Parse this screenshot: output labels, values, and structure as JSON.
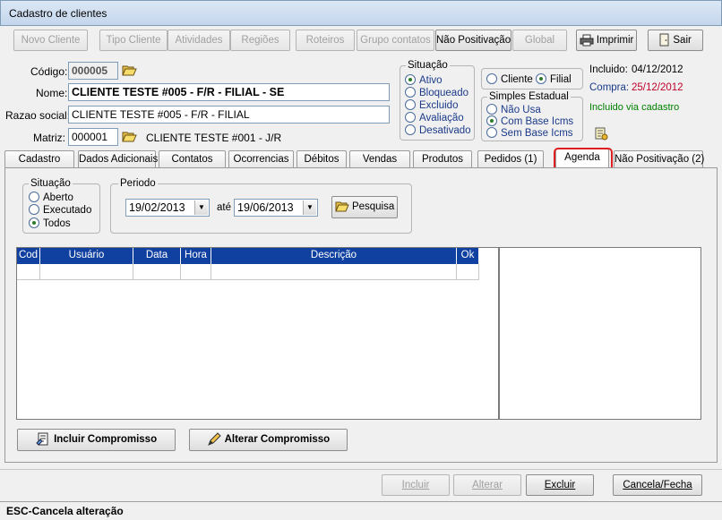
{
  "window": {
    "title": "Cadastro de clientes"
  },
  "toolbar": {
    "novo_cliente": "Novo Cliente",
    "tipo_cliente": "Tipo Cliente",
    "atividades": "Atividades",
    "regioes": "Regiões",
    "roteiros": "Roteiros",
    "grupo_contatos": "Grupo contatos",
    "nao_positivacao": "Não Positivação",
    "global": "Global",
    "imprimir": "Imprimir",
    "sair": "Sair"
  },
  "form": {
    "codigo_label": "Código:",
    "codigo_value": "000005",
    "nome_label": "Nome:",
    "nome_value": "CLIENTE TESTE #005 - F/R - FILIAL - SE",
    "razao_label": "Razao social:",
    "razao_value": "CLIENTE TESTE #005 - F/R - FILIAL",
    "matriz_label": "Matriz:",
    "matriz_value": "000001",
    "matriz_name": "CLIENTE TESTE #001 - J/R"
  },
  "situacao": {
    "title": "Situação",
    "options": [
      "Ativo",
      "Bloqueado",
      "Excluido",
      "Avaliação",
      "Desativado"
    ],
    "selected": "Ativo"
  },
  "tipo": {
    "cliente": "Cliente",
    "filial": "Filial",
    "selected": "Filial"
  },
  "simples": {
    "title": "Simples Estadual",
    "options": [
      "Não Usa",
      "Com Base Icms",
      "Sem Base Icms"
    ],
    "selected": "Com Base Icms"
  },
  "info": {
    "incluido_label": "Incluido:",
    "incluido_value": "04/12/2012",
    "compra_label": "Compra:",
    "compra_value": "25/12/2012",
    "incluido_via": "Incluido via cadastro",
    "colors": {
      "compra": "#c0002a",
      "incluido_via": "#008000"
    }
  },
  "tabs": [
    "Cadastro",
    "Dados Adicionais",
    "Contatos",
    "Ocorrencias",
    "Débitos",
    "Vendas",
    "Produtos",
    "Pedidos (1)",
    "Agenda",
    "Não Positivação (2)"
  ],
  "active_tab": "Agenda",
  "agenda": {
    "situacao_title": "Situação",
    "situacao_options": [
      "Aberto",
      "Executado",
      "Todos"
    ],
    "situacao_selected": "Todos",
    "periodo_title": "Periodo",
    "date_from": "19/02/2013",
    "ate": "até",
    "date_to": "19/06/2013",
    "pesquisa": "Pesquisa",
    "columns": [
      "Cod",
      "Usuário",
      "Data",
      "Hora",
      "Descrição",
      "Ok"
    ],
    "incluir": "Incluir Compromisso",
    "alterar": "Alterar Compromisso"
  },
  "footer": {
    "incluir": "Incluir",
    "alterar": "Alterar",
    "excluir": "Excluir",
    "cancela": "Cancela/Fecha"
  },
  "status": {
    "text": "ESC-Cancela alteração"
  }
}
